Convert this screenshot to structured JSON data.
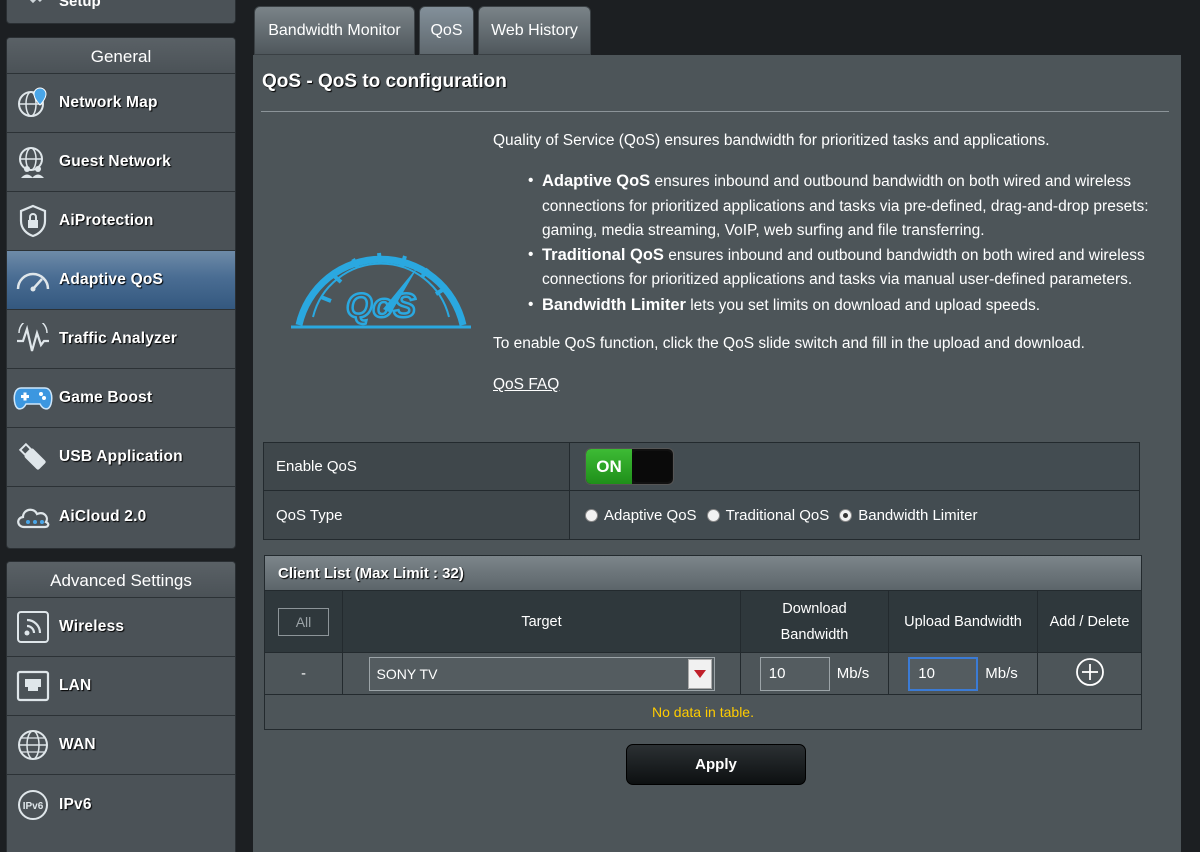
{
  "sidebar": {
    "top_item": {
      "label": "Setup",
      "icon": "wrench-icon"
    },
    "general_header": "General",
    "general_items": [
      {
        "label": "Network Map",
        "icon": "globe-pin-icon",
        "active": false
      },
      {
        "label": "Guest Network",
        "icon": "globe-users-icon",
        "active": false
      },
      {
        "label": "AiProtection",
        "icon": "shield-lock-icon",
        "active": false
      },
      {
        "label": "Adaptive QoS",
        "icon": "speedometer-icon",
        "active": true
      },
      {
        "label": "Traffic Analyzer",
        "icon": "waveform-icon",
        "active": false
      },
      {
        "label": "Game Boost",
        "icon": "gamepad-icon",
        "active": false
      },
      {
        "label": "USB Application",
        "icon": "usb-drive-icon",
        "active": false
      },
      {
        "label": "AiCloud 2.0",
        "icon": "cloud-icon",
        "active": false
      }
    ],
    "advanced_header": "Advanced Settings",
    "advanced_items": [
      {
        "label": "Wireless",
        "icon": "wifi-icon"
      },
      {
        "label": "LAN",
        "icon": "lan-icon"
      },
      {
        "label": "WAN",
        "icon": "globe-icon"
      },
      {
        "label": "IPv6",
        "icon": "ipv6-icon"
      }
    ]
  },
  "tabs": [
    {
      "label": "Bandwidth Monitor",
      "active": false
    },
    {
      "label": "QoS",
      "active": true
    },
    {
      "label": "Web History",
      "active": false
    }
  ],
  "page": {
    "title": "QoS - QoS to configuration",
    "intro": "Quality of Service (QoS) ensures bandwidth for prioritized tasks and applications.",
    "bullets": [
      {
        "bold": "Adaptive QoS",
        "text": " ensures inbound and outbound bandwidth on both wired and wireless connections for prioritized applications and tasks via pre-defined, drag-and-drop presets: gaming, media streaming, VoIP, web surfing and file transferring."
      },
      {
        "bold": "Traditional QoS",
        "text": " ensures inbound and outbound bandwidth on both wired and wireless connections for prioritized applications and tasks via manual user-defined parameters."
      },
      {
        "bold": "Bandwidth Limiter",
        "text": " lets you set limits on download and upload speeds."
      }
    ],
    "enable_note": "To enable QoS function, click the QoS slide switch and fill in the upload and download.",
    "faq_link": "QoS FAQ",
    "logo_text": "QoS"
  },
  "settings": {
    "enable_label": "Enable QoS",
    "toggle_state": "ON",
    "type_label": "QoS Type",
    "type_options": [
      {
        "label": "Adaptive QoS",
        "checked": false
      },
      {
        "label": "Traditional QoS",
        "checked": false
      },
      {
        "label": "Bandwidth Limiter",
        "checked": true
      }
    ]
  },
  "client_list": {
    "title": "Client List (Max Limit : 32)",
    "headers": {
      "all": "All",
      "target": "Target",
      "download_line1": "Download",
      "download_line2": "Bandwidth",
      "upload": "Upload Bandwidth",
      "add_delete": "Add / Delete"
    },
    "row": {
      "index": "-",
      "target_value": "SONY  TV",
      "download_value": "10",
      "download_unit": "Mb/s",
      "upload_value": "10",
      "upload_unit": "Mb/s"
    },
    "empty_message": "No data in table."
  },
  "apply_label": "Apply",
  "colors": {
    "toggle_on": "#2a9d23",
    "active_nav": "#4a6d93",
    "empty_message": "#ffcc00",
    "logo_blue": "#2aa8e0"
  }
}
